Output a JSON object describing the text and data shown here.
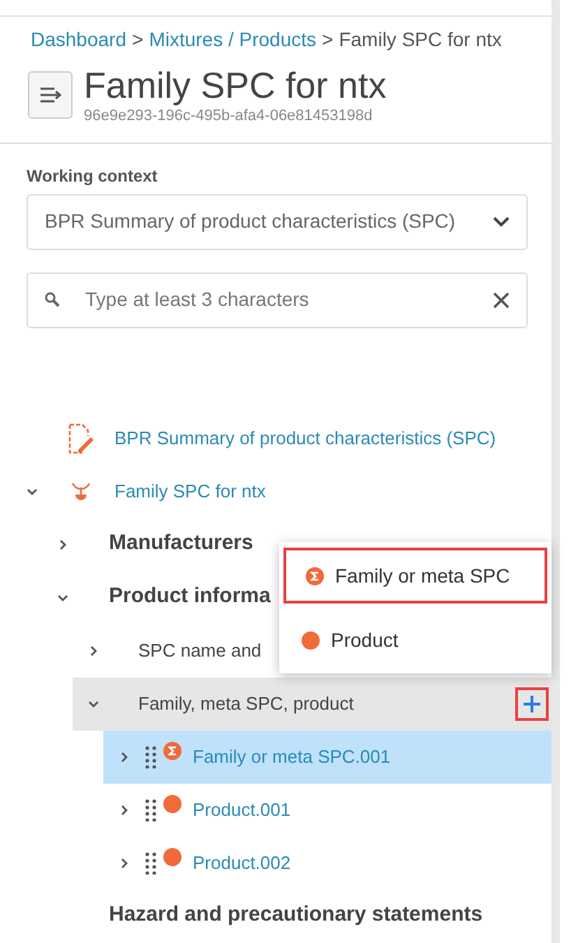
{
  "breadcrumb": [
    {
      "label": "Dashboard",
      "link": true,
      "separator": ">"
    },
    {
      "label": "Mixtures / Products",
      "link": true,
      "separator": ">"
    },
    {
      "label": "Family SPC for ntx",
      "link": false
    }
  ],
  "title": "Family SPC for ntx",
  "id_text": "96e9e293-196c-495b-afa4-06e81453198d",
  "working_context": {
    "label": "Working context",
    "value": "BPR Summary of product characteristics (SPC)"
  },
  "search": {
    "placeholder": "Type at least 3 characters"
  },
  "tree": [
    {
      "kind": "document",
      "label": "BPR Summary of product characteristics (SPC)"
    },
    {
      "kind": "family",
      "label": "Family SPC for ntx",
      "expanded": true,
      "children": [
        {
          "kind": "section",
          "label": "Manufacturers",
          "expanded": false
        },
        {
          "kind": "section",
          "label": "Product informa",
          "expanded": true,
          "children": [
            {
              "kind": "subsection",
              "label": "SPC name and",
              "expanded": false
            },
            {
              "kind": "subsection",
              "label": "Family, meta SPC, product",
              "expanded": true,
              "hovered": true,
              "children": [
                {
                  "kind": "meta",
                  "label": "Family or meta SPC.001",
                  "expanded": false,
                  "selected": true
                },
                {
                  "kind": "product",
                  "label": "Product.001",
                  "expanded": false,
                  "selected": false
                },
                {
                  "kind": "product",
                  "label": "Product.002",
                  "expanded": false,
                  "selected": false
                }
              ]
            }
          ]
        },
        {
          "kind": "section",
          "label": "Hazard and precautionary statements"
        }
      ]
    }
  ],
  "add_menu": [
    {
      "kind": "meta",
      "label": "Family or meta SPC",
      "highlighted": true
    },
    {
      "kind": "product",
      "label": "Product",
      "highlighted": false
    }
  ]
}
